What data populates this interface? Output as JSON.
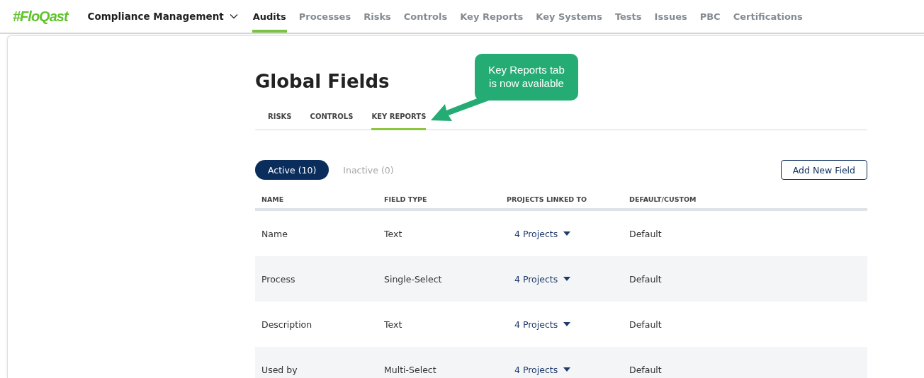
{
  "app": {
    "logo": "#FloQast",
    "module": "Compliance Management"
  },
  "nav": [
    {
      "label": "Audits",
      "selected": true
    },
    {
      "label": "Processes",
      "selected": false
    },
    {
      "label": "Risks",
      "selected": false
    },
    {
      "label": "Controls",
      "selected": false
    },
    {
      "label": "Key Reports",
      "selected": false
    },
    {
      "label": "Key Systems",
      "selected": false
    },
    {
      "label": "Tests",
      "selected": false
    },
    {
      "label": "Issues",
      "selected": false
    },
    {
      "label": "PBC",
      "selected": false
    },
    {
      "label": "Certifications",
      "selected": false
    }
  ],
  "page": {
    "title": "Global Fields"
  },
  "tabs": [
    {
      "label": "RISKS",
      "selected": false
    },
    {
      "label": "CONTROLS",
      "selected": false
    },
    {
      "label": "KEY REPORTS",
      "selected": true
    }
  ],
  "callout": {
    "text": "Key Reports tab is now available"
  },
  "filters": [
    {
      "label": "Active (10)",
      "selected": true
    },
    {
      "label": "Inactive (0)",
      "selected": false
    }
  ],
  "add_button": "Add New Field",
  "table": {
    "columns": [
      "NAME",
      "FIELD TYPE",
      "PROJECTS LINKED TO",
      "DEFAULT/CUSTOM"
    ],
    "rows": [
      {
        "name": "Name",
        "field_type": "Text",
        "projects": "4 Projects",
        "default_custom": "Default"
      },
      {
        "name": "Process",
        "field_type": "Single-Select",
        "projects": "4 Projects",
        "default_custom": "Default"
      },
      {
        "name": "Description",
        "field_type": "Text",
        "projects": "4 Projects",
        "default_custom": "Default"
      },
      {
        "name": "Used by",
        "field_type": "Multi-Select",
        "projects": "4 Projects",
        "default_custom": "Default"
      }
    ]
  }
}
